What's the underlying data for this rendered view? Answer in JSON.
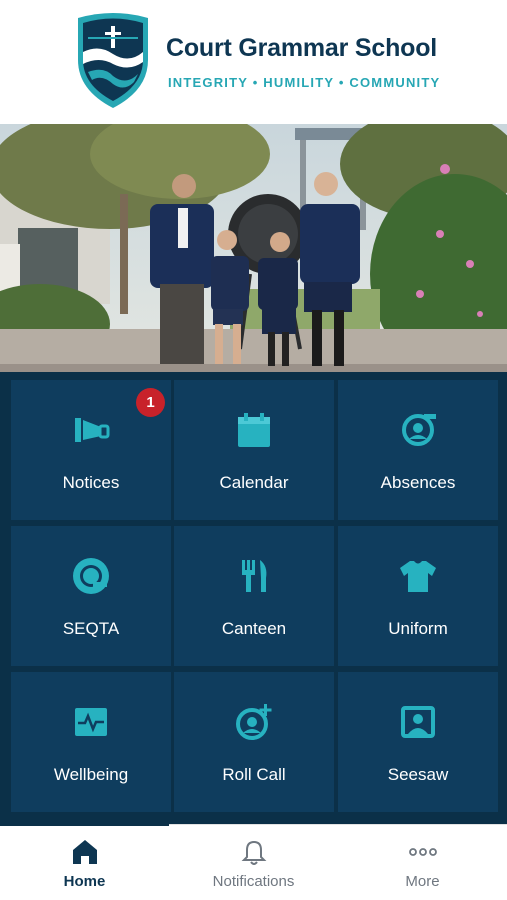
{
  "header": {
    "school_name": "Court Grammar School",
    "motto": "INTEGRITY • HUMILITY • COMMUNITY"
  },
  "colors": {
    "navy": "#0e3652",
    "teal": "#27a7b4",
    "tile": "#0f3d5e",
    "badge": "#c8222a"
  },
  "tiles": [
    {
      "label": "Notices",
      "icon": "megaphone-icon",
      "badge": "1"
    },
    {
      "label": "Calendar",
      "icon": "calendar-icon"
    },
    {
      "label": "Absences",
      "icon": "absence-icon"
    },
    {
      "label": "SEQTA",
      "icon": "seqta-icon"
    },
    {
      "label": "Canteen",
      "icon": "fork-knife-icon"
    },
    {
      "label": "Uniform",
      "icon": "shirt-icon"
    },
    {
      "label": "Wellbeing",
      "icon": "pulse-icon"
    },
    {
      "label": "Roll Call",
      "icon": "add-user-icon"
    },
    {
      "label": "Seesaw",
      "icon": "seesaw-icon"
    }
  ],
  "tabbar": {
    "items": [
      {
        "label": "Home",
        "icon": "home-icon",
        "active": true
      },
      {
        "label": "Notifications",
        "icon": "bell-icon",
        "active": false
      },
      {
        "label": "More",
        "icon": "more-icon",
        "active": false
      }
    ]
  }
}
